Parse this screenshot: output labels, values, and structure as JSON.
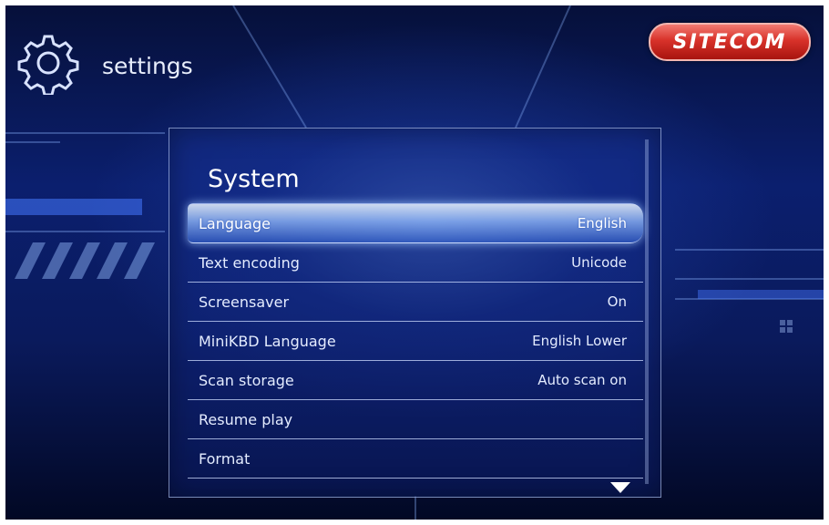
{
  "header": {
    "title": "settings",
    "icon": "gear-icon"
  },
  "brand": {
    "logo_text": "SITECOM",
    "color": "#d8322a"
  },
  "panel": {
    "title": "System",
    "items": [
      {
        "label": "Language",
        "value": "English"
      },
      {
        "label": "Text encoding",
        "value": "Unicode"
      },
      {
        "label": "Screensaver",
        "value": "On"
      },
      {
        "label": "MiniKBD Language",
        "value": "English Lower"
      },
      {
        "label": "Scan storage",
        "value": "Auto scan on"
      },
      {
        "label": "Resume play",
        "value": ""
      },
      {
        "label": "Format",
        "value": ""
      }
    ],
    "selected_index": 0,
    "scroll_icon": "triangle-down-icon"
  },
  "theme": {
    "background": "#0b1f6e",
    "text": "#e4ecff",
    "highlight": "#96beff"
  }
}
